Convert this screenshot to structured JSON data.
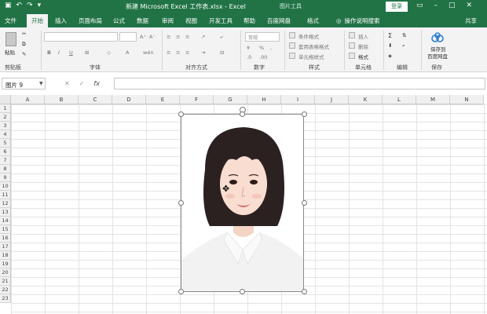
{
  "titlebar": {
    "title": "新建 Microsoft Excel 工作表.xlsx - Excel",
    "contextual_tools": "图片工具",
    "login": "登录",
    "qat_icons": [
      "save-icon",
      "undo-icon",
      "redo-icon",
      "customize-icon"
    ],
    "colors": {
      "accent": "#217346"
    }
  },
  "tabs": {
    "items": [
      "文件",
      "开始",
      "插入",
      "页面布局",
      "公式",
      "数据",
      "审阅",
      "视图",
      "开发工具",
      "帮助",
      "百度网盘",
      "格式"
    ],
    "active": "开始",
    "search_tip": "操作说明搜索",
    "share": "共享"
  },
  "ribbon": {
    "groups": [
      "剪贴板",
      "字体",
      "对齐方式",
      "数字",
      "样式",
      "单元格",
      "编辑",
      "保存"
    ],
    "paste_label": "粘贴",
    "number_format": "常规",
    "conditional_format": "条件格式",
    "table_format": "套用表格格式",
    "cell_styles": "单元格样式",
    "insert": "插入",
    "delete": "删除",
    "format": "格式",
    "save_to_cloud_line1": "保存到",
    "save_to_cloud_line2": "百度网盘"
  },
  "formula_bar": {
    "namebox": "图片 9",
    "fx": "fx",
    "value": ""
  },
  "columns": [
    "A",
    "B",
    "C",
    "D",
    "E",
    "F",
    "G",
    "H",
    "I",
    "J",
    "K",
    "L",
    "M",
    "N"
  ],
  "rows": [
    "1",
    "2",
    "3",
    "4",
    "5",
    "6",
    "7",
    "8",
    "9",
    "10",
    "11",
    "12",
    "13",
    "14",
    "15",
    "16",
    "17",
    "18",
    "19",
    "20",
    "21",
    "22",
    "23"
  ]
}
